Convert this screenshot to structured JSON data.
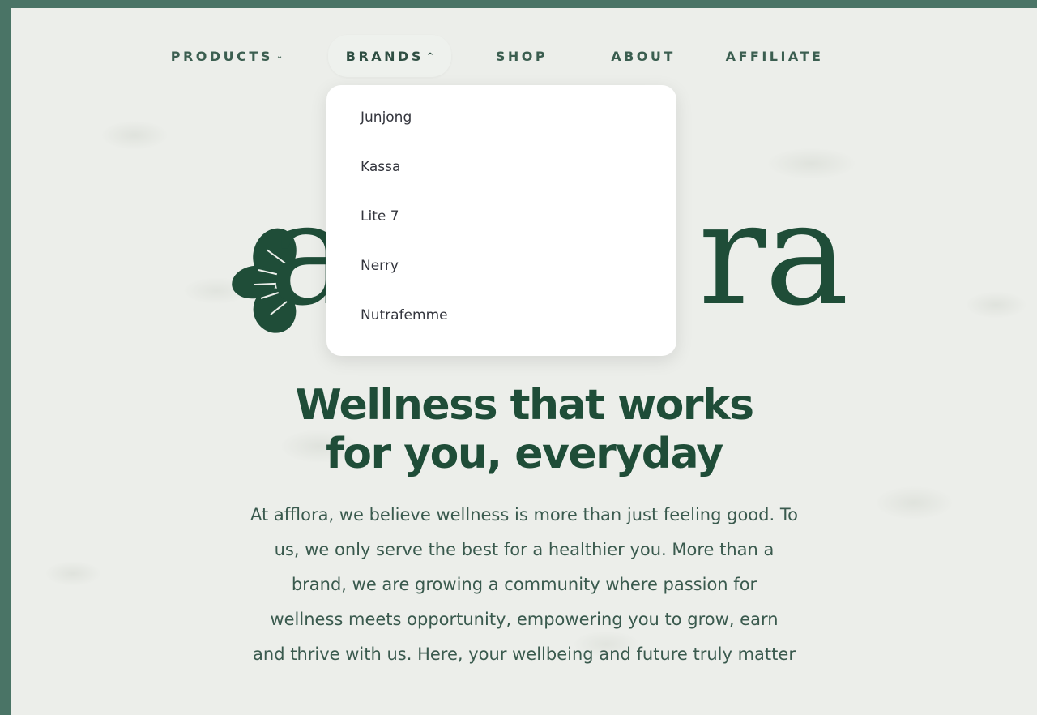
{
  "nav": {
    "products": {
      "label": "PRODUCTS",
      "caret": "⌄"
    },
    "brands": {
      "label": "BRANDS",
      "caret": "^"
    },
    "shop": {
      "label": "SHOP"
    },
    "about": {
      "label": "ABOUT"
    },
    "affiliate": {
      "label": "AFFILIATE"
    }
  },
  "brands_dropdown": {
    "items": [
      "Junjong",
      "Kassa",
      "Lite 7",
      "Nerry",
      "Nutrafemme"
    ]
  },
  "logo": {
    "visible_start": "a",
    "visible_end": "ra",
    "icon": "flower-logo-icon"
  },
  "hero": {
    "headline_line1": "Wellness that works",
    "headline_line2": "for you, everyday",
    "body_lines": [
      "At afflora, we believe wellness is more than just feeling good. To",
      "us, we only serve the best for a healthier you. More than a",
      "brand, we are growing a community where passion for",
      "wellness meets opportunity, empowering you to grow, earn",
      "and thrive with us. Here, your wellbeing and future truly matter"
    ]
  },
  "colors": {
    "brand_green": "#1f4d38",
    "nav_text": "#3b5e50",
    "frame_border": "#4a7466",
    "background": "#eceeea"
  }
}
